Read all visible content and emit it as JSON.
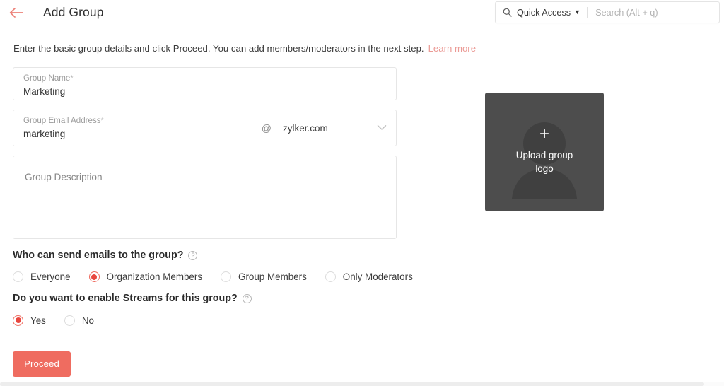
{
  "header": {
    "back_icon": "arrow-left-icon",
    "title": "Add Group"
  },
  "search": {
    "icon": "search-icon",
    "quick_access_label": "Quick Access",
    "caret": "▼",
    "placeholder": "Search (Alt + q)",
    "value": ""
  },
  "intro": {
    "text": "Enter the basic group details and click Proceed. You can add members/moderators in the next step.",
    "link_label": "Learn more"
  },
  "form": {
    "group_name": {
      "label": "Group Name",
      "required_mark": "*",
      "value": "Marketing",
      "placeholder": "Group Name"
    },
    "group_email": {
      "label": "Group Email Address",
      "required_mark": "*",
      "value": "marketing",
      "placeholder": "Group Email Address",
      "at_symbol": "@",
      "domain": "zylker.com",
      "dropdown_icon": "chevron-down-icon"
    },
    "group_description": {
      "placeholder": "Group Description",
      "value": ""
    }
  },
  "questions": [
    {
      "title": "Who can send emails to the group?",
      "help_icon_label": "?",
      "options": [
        {
          "label": "Everyone",
          "selected": false
        },
        {
          "label": "Organization Members",
          "selected": true
        },
        {
          "label": "Group Members",
          "selected": false
        },
        {
          "label": "Only Moderators",
          "selected": false
        }
      ]
    },
    {
      "title": "Do you want to enable Streams for this group?",
      "help_icon_label": "?",
      "options": [
        {
          "label": "Yes",
          "selected": true
        },
        {
          "label": "No",
          "selected": false
        }
      ]
    }
  ],
  "actions": {
    "proceed_label": "Proceed"
  },
  "logo_uploader": {
    "plus_icon": "plus-icon",
    "label": "Upload group logo",
    "background_color": "#4d4d4d",
    "silhouette_color": "#3f3f3f"
  },
  "colors": {
    "accent": "#ef6c60",
    "radio_selected": "#e8473f",
    "link": "#eb9a95",
    "text": "#333333",
    "border": "#e6e6e6"
  }
}
